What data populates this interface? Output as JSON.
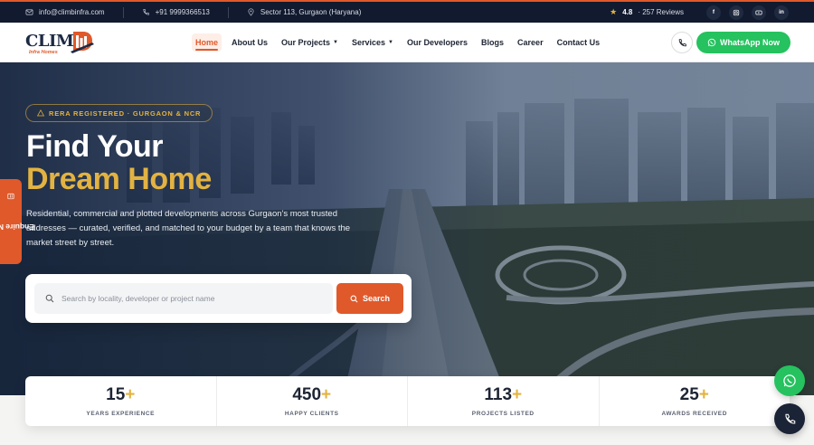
{
  "topbar": {
    "email": "info@climbinfra.com",
    "phone": "+91 9999366513",
    "address": "Sector 113, Gurgaon (Haryana)",
    "rating": "4.8",
    "reviews": "· 257 Reviews",
    "social": [
      "f",
      "ig",
      "yt",
      "in"
    ]
  },
  "logo": {
    "wordmark": "CLIM",
    "tagline": "Infra Homes"
  },
  "nav": {
    "items": [
      {
        "label": "Home",
        "active": true
      },
      {
        "label": "About Us"
      },
      {
        "label": "Our Projects",
        "dropdown": true
      },
      {
        "label": "Services",
        "dropdown": true
      },
      {
        "label": "Our Developers"
      },
      {
        "label": "Blogs"
      },
      {
        "label": "Career"
      },
      {
        "label": "Contact Us"
      }
    ],
    "whatsapp_label": "WhatsApp Now"
  },
  "hero": {
    "badge": "RERA REGISTERED · GURGAON & NCR",
    "title_line1": "Find Your",
    "title_line2": "Dream Home",
    "description": "Residential, commercial and plotted developments across Gurgaon's most trusted addresses — curated, verified, and matched to your budget by a team that knows the market street by street.",
    "search_placeholder": "Search by locality, developer or project name",
    "search_button": "Search"
  },
  "enquire_label": "Enquire Now",
  "stats": [
    {
      "value": "15",
      "suffix": "+",
      "label": "YEARS EXPERIENCE"
    },
    {
      "value": "450",
      "suffix": "+",
      "label": "HAPPY CLIENTS"
    },
    {
      "value": "113",
      "suffix": "+",
      "label": "PROJECTS LISTED"
    },
    {
      "value": "25",
      "suffix": "+",
      "label": "AWARDS RECEIVED"
    }
  ],
  "colors": {
    "accent": "#e0592a",
    "gold": "#e3b341",
    "navy": "#111a2e",
    "whatsapp": "#25c25f"
  }
}
